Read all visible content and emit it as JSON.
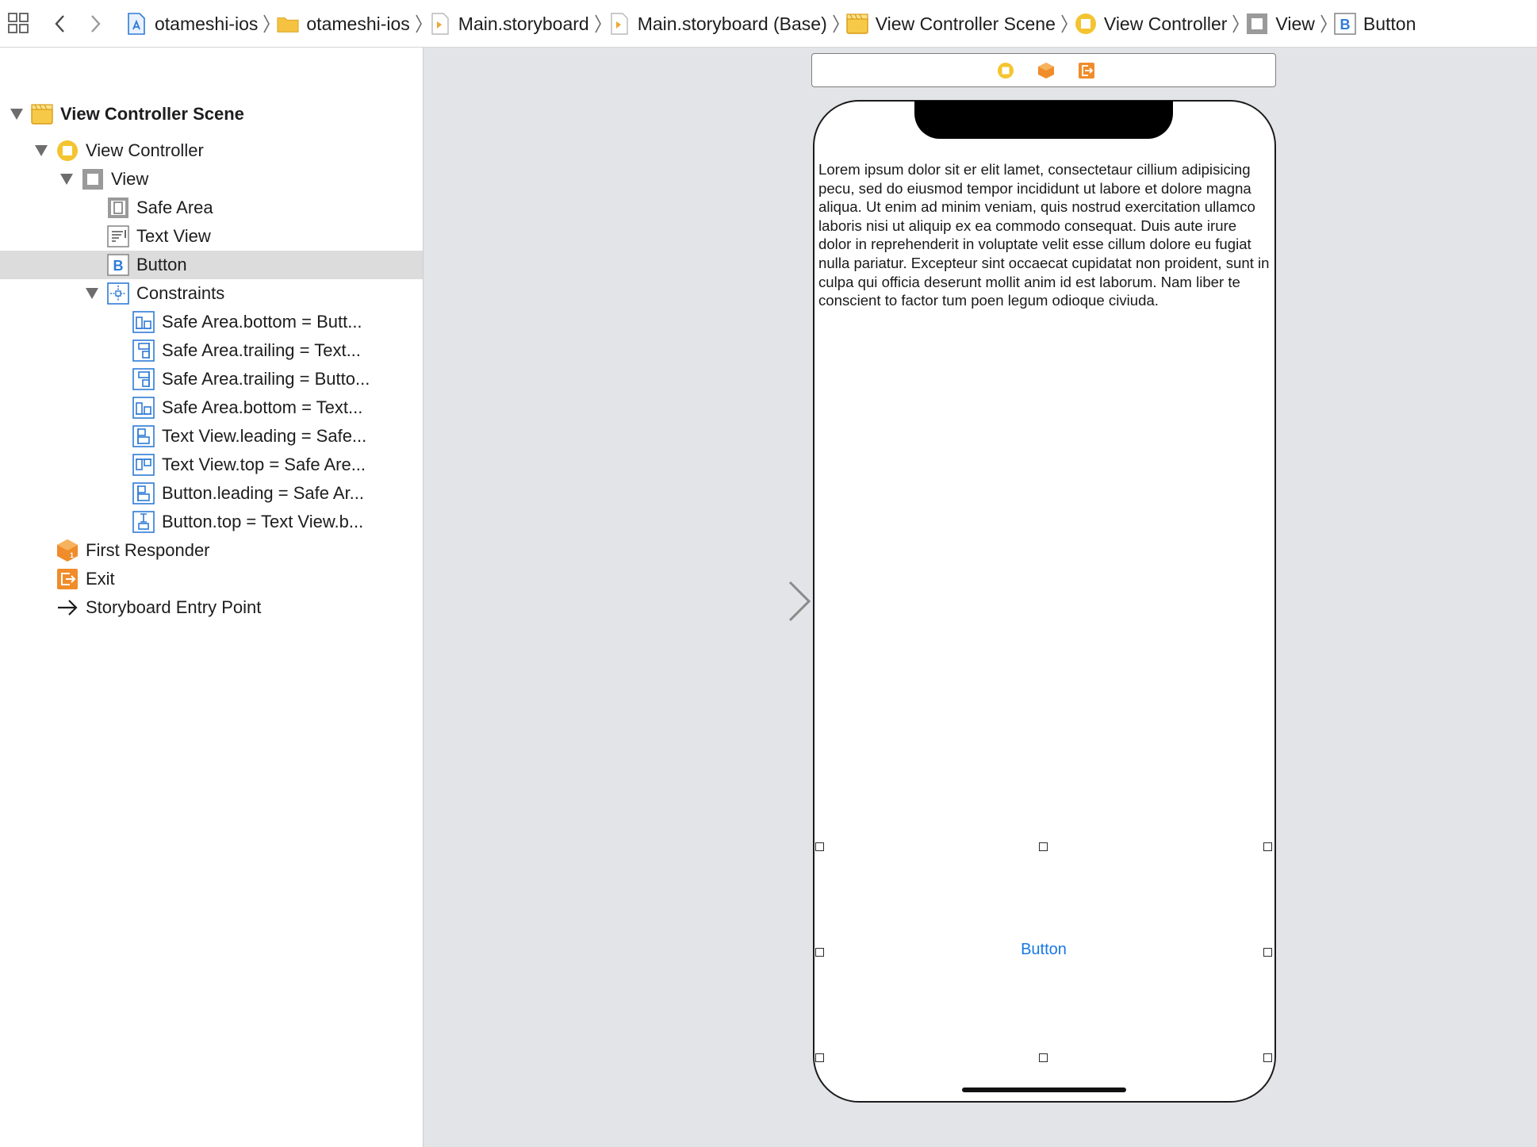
{
  "jumpbar": {
    "crumbs": [
      {
        "label": "otameshi-ios",
        "icon": "project-icon"
      },
      {
        "label": "otameshi-ios",
        "icon": "folder-icon"
      },
      {
        "label": "Main.storyboard",
        "icon": "storyboard-file-icon"
      },
      {
        "label": "Main.storyboard (Base)",
        "icon": "storyboard-file-icon"
      },
      {
        "label": "View Controller Scene",
        "icon": "scene-icon"
      },
      {
        "label": "View Controller",
        "icon": "view-controller-icon"
      },
      {
        "label": "View",
        "icon": "view-icon"
      },
      {
        "label": "Button",
        "icon": "button-icon"
      }
    ]
  },
  "outline": {
    "scene": "View Controller Scene",
    "view_controller": "View Controller",
    "view": "View",
    "safe_area": "Safe Area",
    "text_view": "Text View",
    "button": "Button",
    "constraints_group": "Constraints",
    "constraints": [
      "Safe Area.bottom = Butt...",
      "Safe Area.trailing = Text...",
      "Safe Area.trailing = Butto...",
      "Safe Area.bottom = Text...",
      "Text View.leading = Safe...",
      "Text View.top = Safe Are...",
      "Button.leading = Safe Ar...",
      "Button.top = Text View.b..."
    ],
    "first_responder": "First Responder",
    "exit": "Exit",
    "entry_point": "Storyboard Entry Point",
    "selected": "Button"
  },
  "canvas": {
    "text_view_content": "Lorem ipsum dolor sit er elit lamet, consectetaur cillium adipisicing pecu, sed do eiusmod tempor incididunt ut labore et dolore magna aliqua. Ut enim ad minim veniam, quis nostrud exercitation ullamco laboris nisi ut aliquip ex ea commodo consequat. Duis aute irure dolor in reprehenderit in voluptate velit esse cillum dolore eu fugiat nulla pariatur. Excepteur sint occaecat cupidatat non proident, sunt in culpa qui officia deserunt mollit anim id est laborum. Nam liber te conscient to factor tum poen legum odioque civiuda.",
    "button_label": "Button"
  },
  "colors": {
    "selection": "#dcdcdc",
    "canvas_bg": "#e3e4e8",
    "button_text": "#1878e8",
    "accent_blue": "#2e7bd6",
    "accent_orange": "#f09a36",
    "accent_yellow": "#f4c430"
  }
}
